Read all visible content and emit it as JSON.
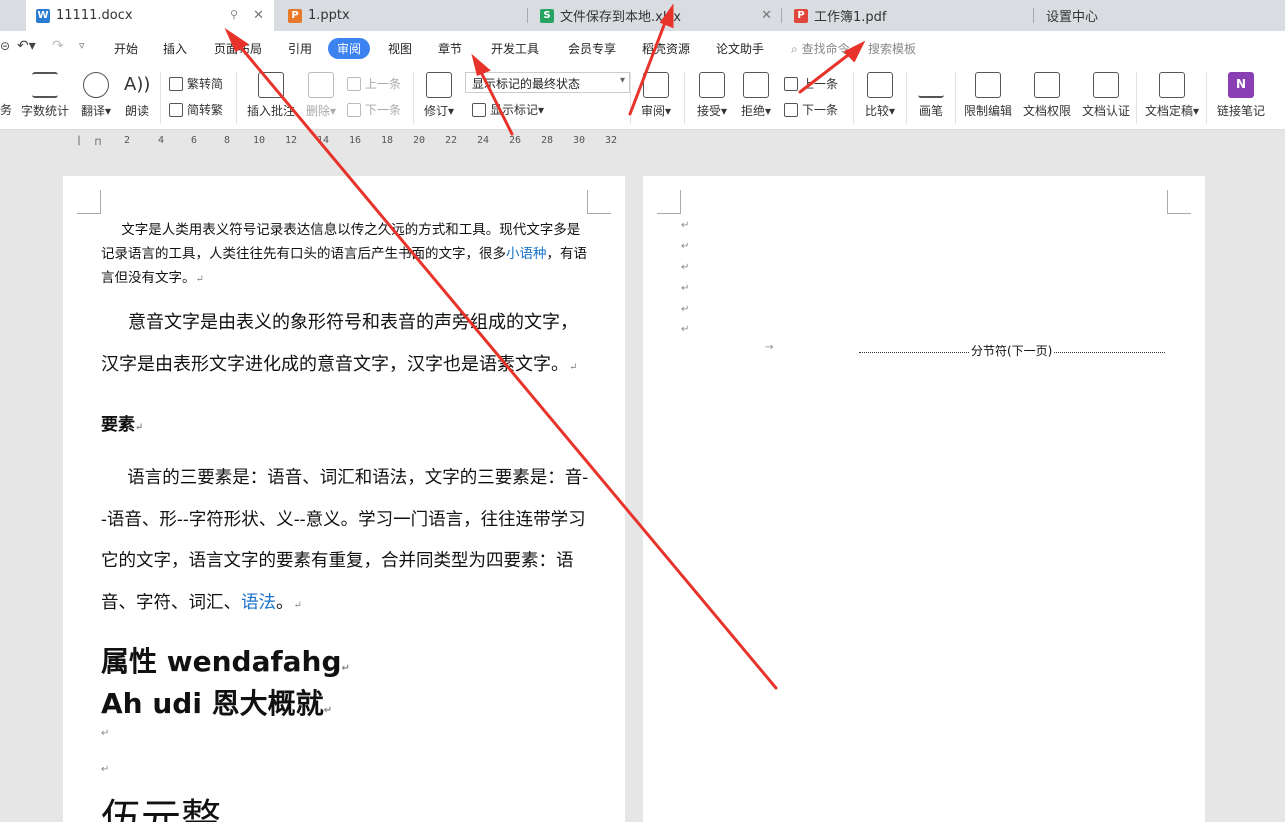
{
  "tabs": [
    {
      "label": "11111.docx",
      "icon": "word-icon",
      "color": "#2b7cd3",
      "glyph": "W",
      "active": true
    },
    {
      "label": "1.pptx",
      "icon": "ppt-icon",
      "color": "#e8792b",
      "glyph": "P"
    },
    {
      "label": "文件保存到本地.xlsx",
      "icon": "excel-icon",
      "color": "#27a560",
      "glyph": "S"
    },
    {
      "label": "工作簿1.pdf",
      "icon": "pdf-icon",
      "color": "#e0463a",
      "glyph": "P"
    },
    {
      "label": "设置中心"
    }
  ],
  "menu": [
    "开始",
    "插入",
    "页面布局",
    "引用",
    "审阅",
    "视图",
    "章节",
    "开发工具",
    "会员专享",
    "稻壳资源",
    "论文助手"
  ],
  "menu_active": "审阅",
  "search": {
    "command": "查找命令",
    "template": "搜索模板"
  },
  "ribbon": {
    "left_cut": "务",
    "word_count": "字数统计",
    "translate": "翻译",
    "read_aloud": "朗读",
    "trad_simp": "繁转简",
    "simp_trad": "简转繁",
    "insert_comment": "插入批注",
    "delete": "删除",
    "prev": "上一条",
    "next": "下一条",
    "revise": "修订",
    "show_markup": "显示标记",
    "markup_state": "显示标记的最终状态",
    "review": "审阅",
    "accept": "接受",
    "reject": "拒绝",
    "prev2": "上一条",
    "next2": "下一条",
    "compare": "比较",
    "pen": "画笔",
    "restrict_edit": "限制编辑",
    "doc_permission": "文档权限",
    "doc_auth": "文档认证",
    "doc_finalize": "文档定稿",
    "link_notes": "链接笔记"
  },
  "ruler_ticks": [
    "2",
    "4",
    "6",
    "8",
    "10",
    "12",
    "14",
    "16",
    "18",
    "20",
    "22",
    "24",
    "26",
    "28",
    "30",
    "32"
  ],
  "doc": {
    "p1": "文字是人类用表义符号记录表达信息以传之久远的方式和工具。现代文字多是记录语言的工具，人类往往先有口头的语言后产生书面的文字，很多",
    "p1_link": "小语种",
    "p1_tail": "，有语言但没有文字。",
    "p2": "意音文字是由表义的象形符号和表音的声旁组成的文字，汉字是由表形文字进化成的意音文字，汉字也是语素文字。",
    "heading": "要素",
    "p3": "语言的三要素是：语音、词汇和语法，文字的三要素是：音--语音、形--字符形状、义--意义。学习一门语言，往往连带学习它的文字，语言文字的要素有重复，合并同类型为四要素：语音、字符、词汇、",
    "p3_link": "语法",
    "p3_tail": "。",
    "h_attr": "属性 wendafahg",
    "h_ahudi": "Ah udi 恩大概就",
    "big": "伍元整",
    "section_break": "分节符(下一页)"
  },
  "arrow_color": "#e8332a"
}
